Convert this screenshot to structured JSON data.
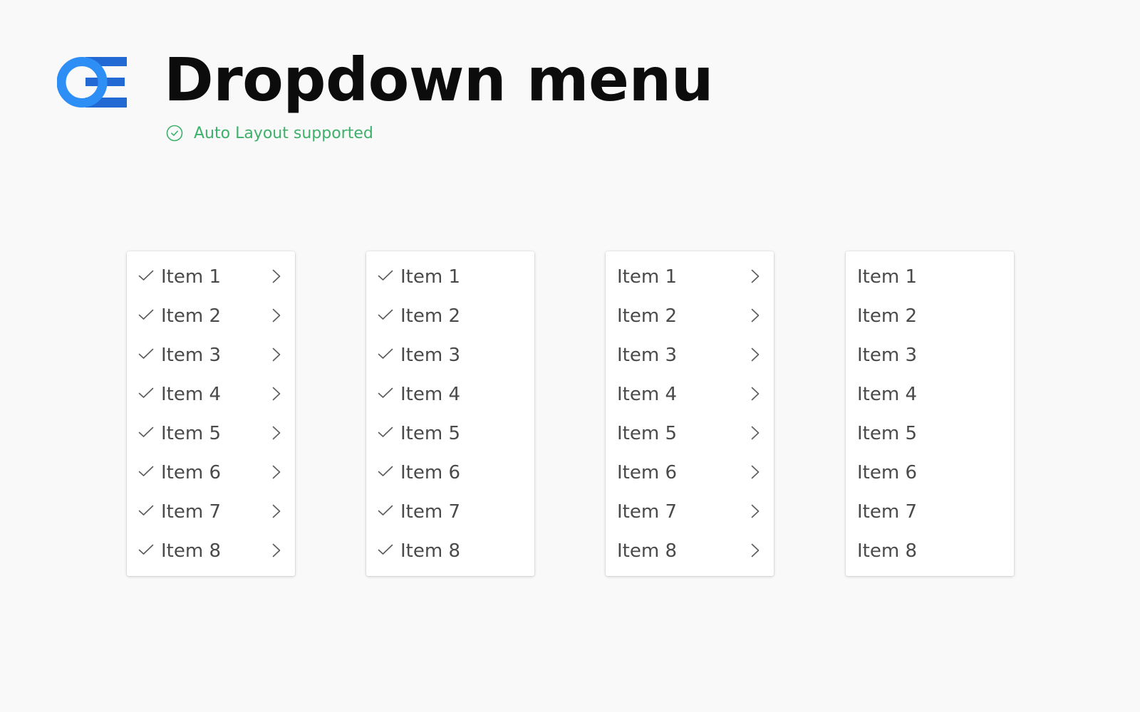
{
  "header": {
    "logo_icon": "oe-logo-icon",
    "title": "Dropdown menu",
    "subtitle": {
      "icon": "check-circle-icon",
      "text": "Auto Layout supported"
    }
  },
  "colors": {
    "background": "#f9f9f9",
    "logo_circle": "#2d8ef5",
    "logo_bars": "#2269d4",
    "success_green": "#3db06b",
    "item_text": "#4a4a4a",
    "title_text": "#0c0c0c"
  },
  "menus": [
    {
      "variant": "check-and-chevron",
      "show_check": true,
      "show_chevron": true,
      "items": [
        {
          "label": "Item 1"
        },
        {
          "label": "Item 2"
        },
        {
          "label": "Item 3"
        },
        {
          "label": "Item 4"
        },
        {
          "label": "Item 5"
        },
        {
          "label": "Item 6"
        },
        {
          "label": "Item 7"
        },
        {
          "label": "Item 8"
        }
      ]
    },
    {
      "variant": "check-only",
      "show_check": true,
      "show_chevron": false,
      "items": [
        {
          "label": "Item 1"
        },
        {
          "label": "Item 2"
        },
        {
          "label": "Item 3"
        },
        {
          "label": "Item 4"
        },
        {
          "label": "Item 5"
        },
        {
          "label": "Item 6"
        },
        {
          "label": "Item 7"
        },
        {
          "label": "Item 8"
        }
      ]
    },
    {
      "variant": "chevron-only",
      "show_check": false,
      "show_chevron": true,
      "items": [
        {
          "label": "Item 1"
        },
        {
          "label": "Item 2"
        },
        {
          "label": "Item 3"
        },
        {
          "label": "Item 4"
        },
        {
          "label": "Item 5"
        },
        {
          "label": "Item 6"
        },
        {
          "label": "Item 7"
        },
        {
          "label": "Item 8"
        }
      ]
    },
    {
      "variant": "text-only",
      "show_check": false,
      "show_chevron": false,
      "items": [
        {
          "label": "Item 1"
        },
        {
          "label": "Item 2"
        },
        {
          "label": "Item 3"
        },
        {
          "label": "Item 4"
        },
        {
          "label": "Item 5"
        },
        {
          "label": "Item 6"
        },
        {
          "label": "Item 7"
        },
        {
          "label": "Item 8"
        }
      ]
    }
  ]
}
